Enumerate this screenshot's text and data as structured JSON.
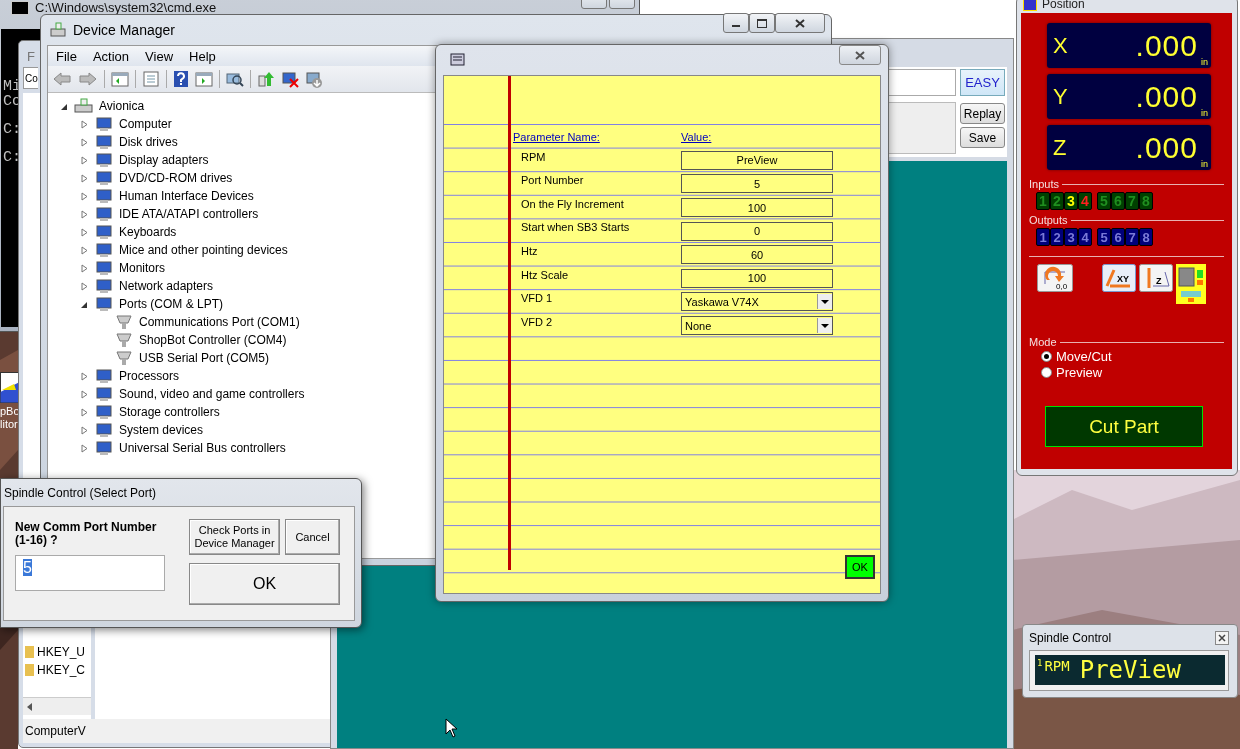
{
  "cmd_window": {
    "title": "C:\\Windows\\system32\\cmd.exe",
    "lines": [
      "Mi",
      "Co",
      "C:",
      "C:"
    ]
  },
  "registry_window": {
    "menu_letter": "F",
    "address": "Co",
    "tree": [
      "HKEY_U",
      "HKEY_C"
    ],
    "status": "ComputerV"
  },
  "desktop_icon": {
    "label_lines": [
      "pBo",
      "litor"
    ]
  },
  "device_manager": {
    "title": "Device Manager",
    "menu": [
      "File",
      "Action",
      "View",
      "Help"
    ],
    "tree": {
      "label": "Avionica",
      "expanded": true,
      "children": [
        {
          "label": "Computer",
          "expanded": false
        },
        {
          "label": "Disk drives",
          "expanded": false
        },
        {
          "label": "Display adapters",
          "expanded": false
        },
        {
          "label": "DVD/CD-ROM drives",
          "expanded": false
        },
        {
          "label": "Human Interface Devices",
          "expanded": false
        },
        {
          "label": "IDE ATA/ATAPI controllers",
          "expanded": false
        },
        {
          "label": "Keyboards",
          "expanded": false
        },
        {
          "label": "Mice and other pointing devices",
          "expanded": false
        },
        {
          "label": "Monitors",
          "expanded": false
        },
        {
          "label": "Network adapters",
          "expanded": false
        },
        {
          "label": "Ports (COM & LPT)",
          "expanded": true,
          "children": [
            {
              "label": "Communications Port (COM1)"
            },
            {
              "label": "ShopBot Controller (COM4)"
            },
            {
              "label": "USB Serial Port (COM5)"
            }
          ]
        },
        {
          "label": "Processors",
          "expanded": false
        },
        {
          "label": "Sound, video and game controllers",
          "expanded": false
        },
        {
          "label": "Storage controllers",
          "expanded": false
        },
        {
          "label": "System devices",
          "expanded": false
        },
        {
          "label": "Universal Serial Bus controllers",
          "expanded": false
        }
      ]
    }
  },
  "shopbot_window": {
    "buttons": [
      "EASY",
      "Replay",
      "Save"
    ]
  },
  "parameters_dialog": {
    "headers": [
      "Parameter Name:",
      "Value:"
    ],
    "rows": [
      {
        "name": "RPM",
        "kind": "text",
        "value": "PreView"
      },
      {
        "name": "Port Number",
        "kind": "text",
        "value": "5"
      },
      {
        "name": "On the Fly Increment",
        "kind": "text",
        "value": "100"
      },
      {
        "name": "Start when SB3 Starts",
        "kind": "text",
        "value": "0"
      },
      {
        "name": "Htz",
        "kind": "text",
        "value": "60"
      },
      {
        "name": "Htz Scale",
        "kind": "text",
        "value": "100"
      },
      {
        "name": "VFD 1",
        "kind": "select",
        "value": "Yaskawa V74X"
      },
      {
        "name": "VFD 2",
        "kind": "select",
        "value": "None"
      }
    ],
    "ok": "OK"
  },
  "position_panel": {
    "title": "Position",
    "axes": [
      {
        "axis": "X",
        "value": ".000",
        "unit": "in"
      },
      {
        "axis": "Y",
        "value": ".000",
        "unit": "in"
      },
      {
        "axis": "Z",
        "value": ".000",
        "unit": "in"
      }
    ],
    "inputs_label": "Inputs",
    "inputs": [
      {
        "label": "1",
        "color": "#1f8f1f"
      },
      {
        "label": "2",
        "color": "#1f8f1f"
      },
      {
        "label": "3",
        "color": "#ffff00"
      },
      {
        "label": "4",
        "color": "#ff2020"
      },
      {
        "label": "5",
        "color": "#1f8f1f"
      },
      {
        "label": "6",
        "color": "#1f8f1f"
      },
      {
        "label": "7",
        "color": "#1f8f1f"
      },
      {
        "label": "8",
        "color": "#1f8f1f"
      }
    ],
    "outputs_label": "Outputs",
    "outputs": [
      "1",
      "2",
      "3",
      "4",
      "5",
      "6",
      "7",
      "8"
    ],
    "mode_label": "Mode",
    "modes": [
      {
        "label": "Move/Cut",
        "selected": true
      },
      {
        "label": "Preview",
        "selected": false
      }
    ],
    "tool_labels": [
      "0,0",
      "XY",
      "Z"
    ],
    "cut_button": "Cut Part"
  },
  "spindle_display": {
    "title": "Spindle Control",
    "index": "1",
    "label": "RPM",
    "value": "PreView"
  },
  "port_dialog": {
    "title": "Spindle Control (Select Port)",
    "prompt": "New Comm Port Number (1-16) ?",
    "value": "5",
    "buttons": [
      "Check Ports in Device Manager",
      "Cancel",
      "OK"
    ]
  }
}
